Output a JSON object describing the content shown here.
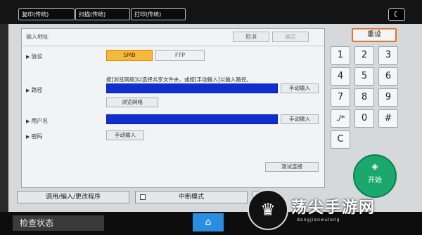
{
  "tabs": [
    "复印(传统)",
    "扫描(传统)",
    "打印(传统)"
  ],
  "night_icon": "moon-icon",
  "dialog": {
    "title": "输入地址",
    "cancel": "取消",
    "ok": "确定",
    "protocol_label": "协议",
    "protocol_options": [
      "SMB",
      "FTP"
    ],
    "selected_protocol": "SMB",
    "hint": "按[浏览网络]以选择共享文件夹，或按[手动输入]以输入路径。",
    "path_label": "路径",
    "manual_input": "手动输入",
    "browse_network": "浏览网络",
    "username_label": "用户名",
    "password_label": "密码",
    "test_connection": "测试连接"
  },
  "keypad": {
    "reset": "重设",
    "keys": [
      "1",
      "2",
      "3",
      "4",
      "5",
      "6",
      "7",
      "8",
      "9",
      "./*",
      "0",
      "#",
      "C"
    ],
    "start": "开始"
  },
  "bottom": {
    "program": "调用/编入/更改程序",
    "interrupt": "中断模式"
  },
  "statusbar": {
    "check_status": "检查状态"
  },
  "watermark": {
    "text": "荡尖手游网",
    "sub": "dangjianwulong"
  },
  "colors": {
    "selected": "#f6b93b",
    "field_blue": "#0f2fd1",
    "start_green": "#1aa86d",
    "reset_border": "#e0762e",
    "home_blue": "#2a8ee0"
  }
}
